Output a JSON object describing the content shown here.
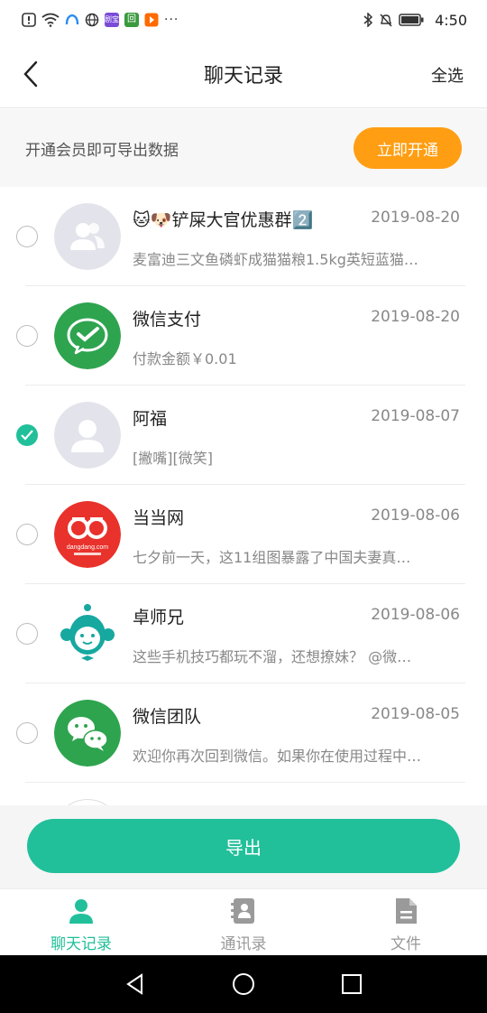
{
  "status_bar": {
    "time": "4:50",
    "more": "···",
    "colors": {
      "app1": "#2a8cf0",
      "app2": "#7b4bd8",
      "app3": "#3a9a3e",
      "app4": "#ff6a00"
    },
    "app1_label": "剧宝",
    "app2_label": "回"
  },
  "navbar": {
    "title": "聊天记录",
    "select_all": "全选"
  },
  "vip": {
    "text": "开通会员即可导出数据",
    "button": "立即开通"
  },
  "chats": [
    {
      "name": "🐱🐶铲屎大官优惠群2️⃣",
      "date": "2019-08-20",
      "preview": "麦富迪三文鱼磷虾成猫猫粮1.5kg英短蓝猫…",
      "checked": false,
      "avatar": "group-avatar-icon"
    },
    {
      "name": "微信支付",
      "date": "2019-08-20",
      "preview": "付款金额￥0.01",
      "checked": false,
      "avatar": "wechat-pay-icon"
    },
    {
      "name": "阿福",
      "date": "2019-08-07",
      "preview": "[撇嘴][微笑]",
      "checked": true,
      "avatar": "person-avatar-icon"
    },
    {
      "name": "当当网",
      "date": "2019-08-06",
      "preview": "七夕前一天，这11组图暴露了中国夫妻真…",
      "checked": false,
      "avatar": "dangdang-logo",
      "logo_text": "dangdang.com"
    },
    {
      "name": "卓师兄",
      "date": "2019-08-06",
      "preview": "这些手机技巧都玩不溜，还想撩妹？ @微…",
      "checked": false,
      "avatar": "monkey-logo"
    },
    {
      "name": "微信团队",
      "date": "2019-08-05",
      "preview": "欢迎你再次回到微信。如果你在使用过程中…",
      "checked": false,
      "avatar": "wechat-team-icon"
    }
  ],
  "export": {
    "button": "导出"
  },
  "tabs": [
    {
      "label": "聊天记录",
      "icon": "person-icon",
      "active": true
    },
    {
      "label": "通讯录",
      "icon": "contacts-icon",
      "active": false
    },
    {
      "label": "文件",
      "icon": "file-icon",
      "active": false
    }
  ],
  "theme": {
    "accent": "#21c09a",
    "orange": "#ff9e12"
  }
}
